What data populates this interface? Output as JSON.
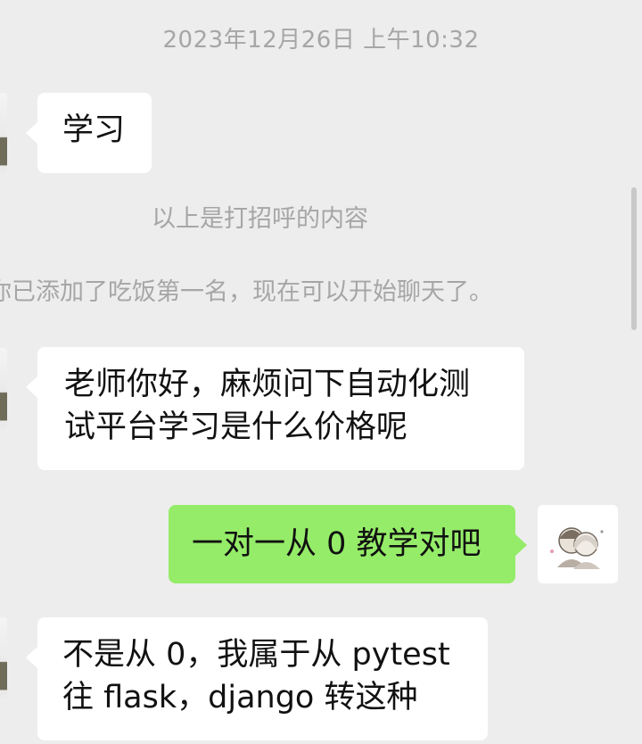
{
  "chat": {
    "timestamp": "2023年12月26日 上午10:32",
    "messages": [
      {
        "side": "left",
        "text": "学习"
      },
      {
        "side": "system",
        "text": "以上是打招呼的内容"
      },
      {
        "side": "system",
        "text": "你已添加了吃饭第一名，现在可以开始聊天了。"
      },
      {
        "side": "left",
        "text": "老师你好，麻烦问下自动化测试平台学习是什么价格呢"
      },
      {
        "side": "right",
        "text": "一对一从 0 教学对吧"
      },
      {
        "side": "left",
        "text": "不是从 0，我属于从 pytest 往 flask，django 转这种"
      }
    ]
  },
  "colors": {
    "background": "#ededed",
    "bubble_incoming": "#ffffff",
    "bubble_outgoing": "#95ec69",
    "system_text": "#a6a6a6"
  },
  "icons": {
    "contact_avatar": "contact-avatar-icon",
    "my_avatar": "couple-illustration-avatar-icon"
  }
}
